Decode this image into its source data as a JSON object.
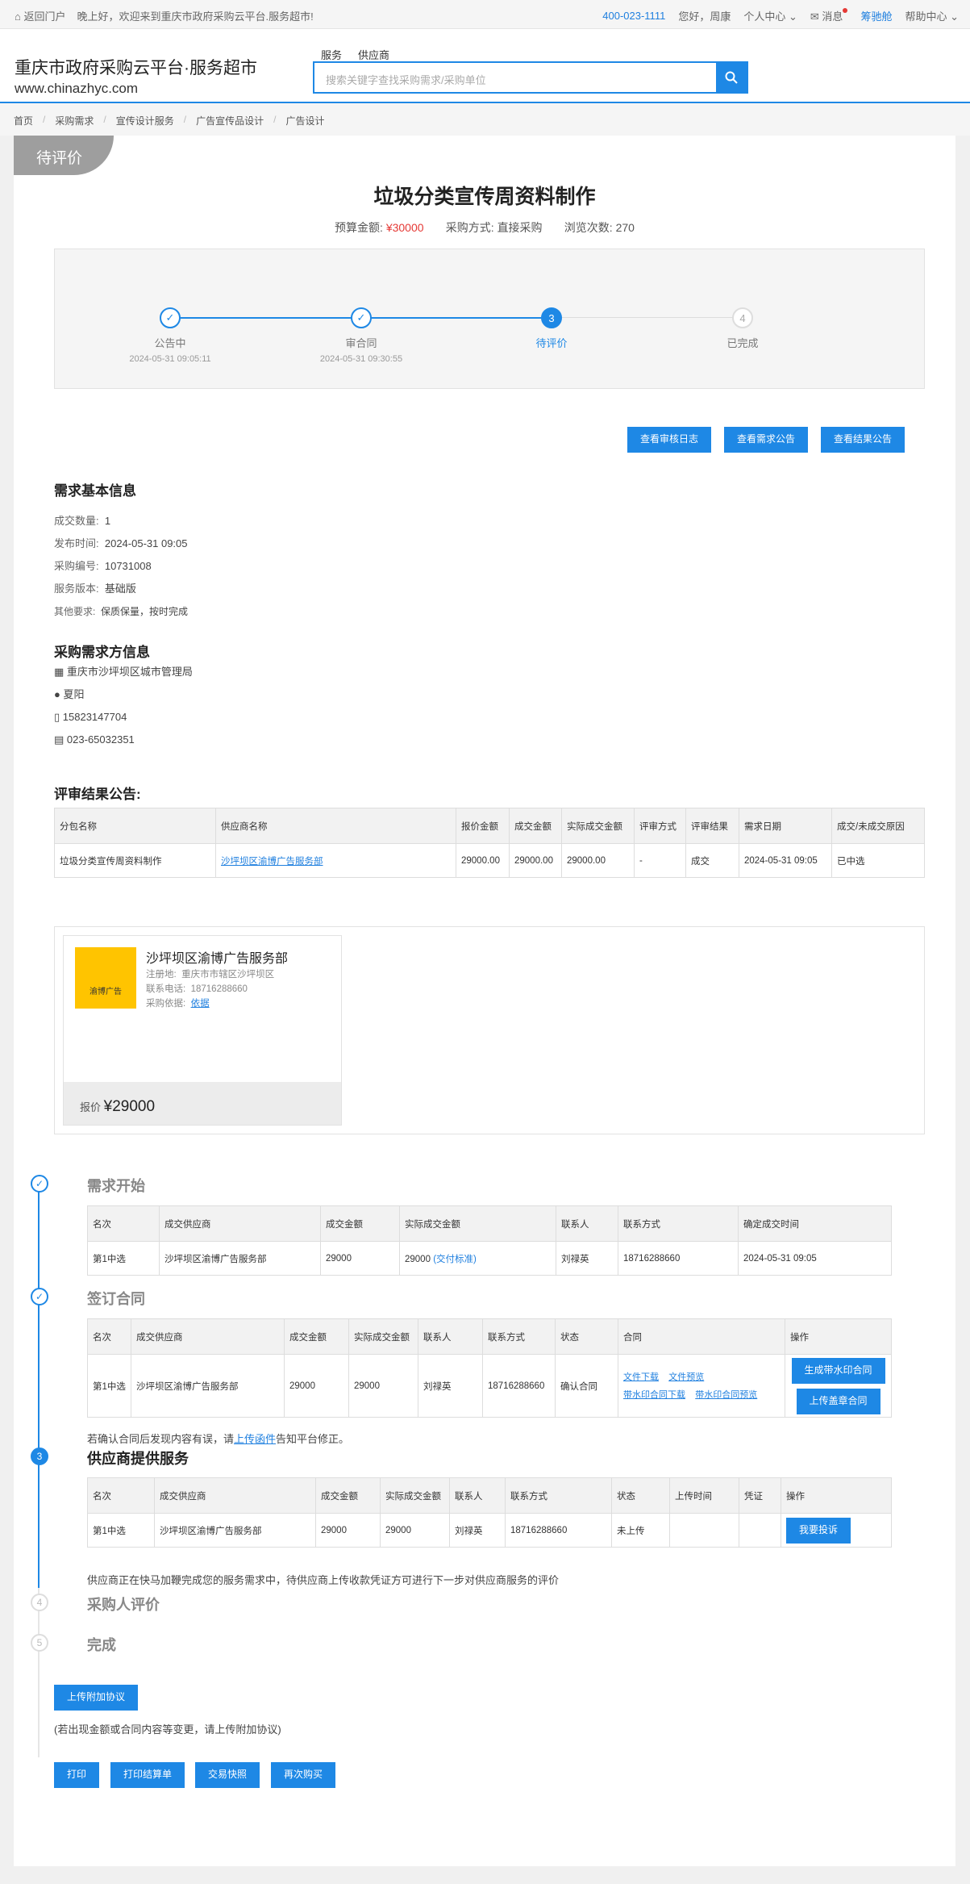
{
  "topbar": {
    "home": "返回门户",
    "greet": "晚上好，欢迎来到重庆市政府采购云平台.服务超市!",
    "phone": "400-023-1111",
    "hello": "您好，周康",
    "center": "个人中心",
    "msg": "消息",
    "user": "筹驰舱",
    "help": "帮助中心"
  },
  "header": {
    "title": "重庆市政府采购云平台·服务超市",
    "url": "www.chinazhyc.com",
    "tab_service": "服务",
    "tab_supplier": "供应商",
    "search_placeholder": "搜索关键字查找采购需求/采购单位"
  },
  "breadcrumb": [
    "首页",
    "采购需求",
    "宣传设计服务",
    "广告宣传品设计",
    "广告设计"
  ],
  "status_tag": "待评价",
  "project": {
    "title": "垃圾分类宣传周资料制作",
    "budget_label": "预算金额:",
    "budget": "¥30000",
    "method_label": "采购方式:",
    "method": "直接采购",
    "views_label": "浏览次数:",
    "views": "270"
  },
  "steps": [
    {
      "num": "✓",
      "name": "公告中",
      "time": "2024-05-31 09:05:11"
    },
    {
      "num": "✓",
      "name": "审合同",
      "time": "2024-05-31 09:30:55"
    },
    {
      "num": "3",
      "name": "待评价",
      "time": ""
    },
    {
      "num": "4",
      "name": "已完成",
      "time": ""
    }
  ],
  "actions": [
    "查看审核日志",
    "查看需求公告",
    "查看结果公告"
  ],
  "basic": {
    "title": "需求基本信息",
    "rows": [
      {
        "k": "成交数量:",
        "v": "1"
      },
      {
        "k": "发布时间:",
        "v": "2024-05-31 09:05"
      },
      {
        "k": "采购编号:",
        "v": "10731008"
      },
      {
        "k": "服务版本:",
        "v": "基础版"
      },
      {
        "k": "其他要求:",
        "v": "保质保量，按时完成"
      }
    ]
  },
  "buyer": {
    "title": "采购需求方信息",
    "org": "重庆市沙坪坝区城市管理局",
    "person": "夏阳",
    "mobile": "15823147704",
    "phone": "023-65032351"
  },
  "result": {
    "title": "评审结果公告:",
    "headers": [
      "分包名称",
      "供应商名称",
      "报价金额",
      "成交金额",
      "实际成交金额",
      "评审方式",
      "评审结果",
      "需求日期",
      "成交/未成交原因"
    ],
    "row": [
      "垃圾分类宣传周资料制作",
      "沙坪坝区渝博广告服务部",
      "29000.00",
      "29000.00",
      "29000.00",
      "-",
      "成交",
      "2024-05-31 09:05",
      "已中选"
    ]
  },
  "supplier": {
    "name": "沙坪坝区渝博广告服务部",
    "addr_label": "注册地:",
    "addr": "重庆市市辖区沙坪坝区",
    "tel_label": "联系电话:",
    "tel": "18716288660",
    "basis_label": "采购依据:",
    "basis": "依据",
    "logo_text": "渝博广告",
    "price_label": "报价",
    "price": "¥29000"
  },
  "timeline": {
    "s1": {
      "title": "需求开始",
      "headers": [
        "名次",
        "成交供应商",
        "成交金额",
        "实际成交金额",
        "联系人",
        "联系方式",
        "确定成交时间"
      ],
      "row": [
        "第1中选",
        "沙坪坝区渝博广告服务部",
        "29000",
        "29000",
        "刘禄英",
        "18716288660",
        "2024-05-31 09:05"
      ],
      "extra": "(交付标准)"
    },
    "s2": {
      "title": "签订合同",
      "headers": [
        "名次",
        "成交供应商",
        "成交金额",
        "实际成交金额",
        "联系人",
        "联系方式",
        "状态",
        "合同",
        "操作"
      ],
      "row": [
        "第1中选",
        "沙坪坝区渝博广告服务部",
        "29000",
        "29000",
        "刘禄英",
        "18716288660",
        "确认合同"
      ],
      "links": [
        "文件下载",
        "文件预览",
        "带水印合同下载",
        "带水印合同预览"
      ],
      "ops": [
        "生成带水印合同",
        "上传盖章合同"
      ],
      "note_pre": "若确认合同后发现内容有误，请",
      "note_link": "上传函件",
      "note_post": "告知平台修正。"
    },
    "s3": {
      "title": "供应商提供服务",
      "headers": [
        "名次",
        "成交供应商",
        "成交金额",
        "实际成交金额",
        "联系人",
        "联系方式",
        "状态",
        "上传时间",
        "凭证",
        "操作"
      ],
      "row": [
        "第1中选",
        "沙坪坝区渝博广告服务部",
        "29000",
        "29000",
        "刘禄英",
        "18716288660",
        "未上传",
        "",
        ""
      ],
      "op": "我要投诉",
      "note": "供应商正在快马加鞭完成您的服务需求中，待供应商上传收款凭证方可进行下一步对供应商服务的评价"
    },
    "s4": {
      "title": "采购人评价",
      "num": "4"
    },
    "s5": {
      "title": "完成",
      "num": "5"
    }
  },
  "attach": {
    "btn": "上传附加协议",
    "note": "(若出现金额或合同内容等变更，请上传附加协议)"
  },
  "bottom_btns": [
    "打印",
    "打印结算单",
    "交易快照",
    "再次购买"
  ]
}
